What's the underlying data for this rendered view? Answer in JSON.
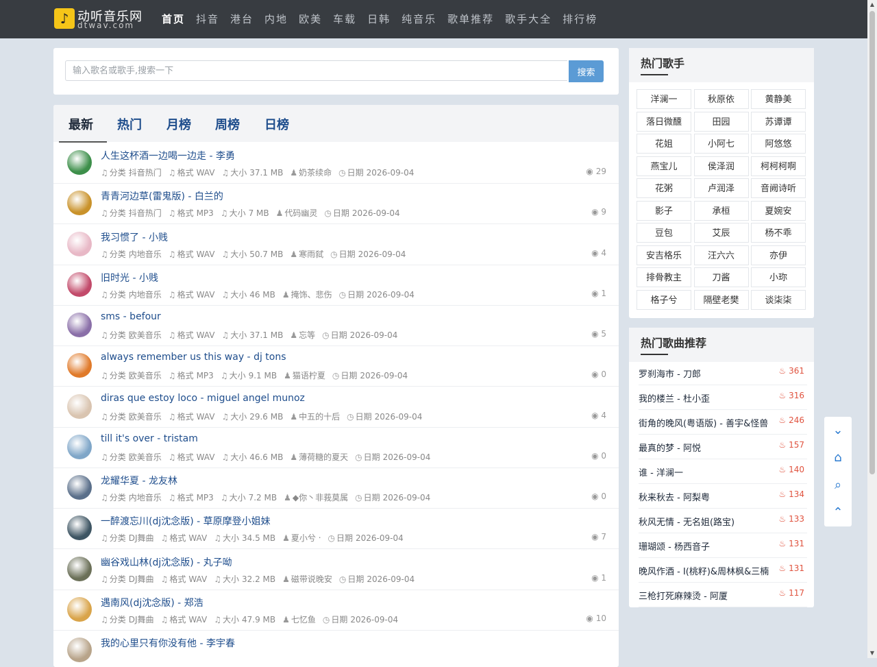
{
  "brand": {
    "name": "动听音乐网",
    "domain": "dtwav.com",
    "logo_glyph": "♪"
  },
  "nav": [
    "首页",
    "抖音",
    "港台",
    "内地",
    "欧美",
    "车载",
    "日韩",
    "纯音乐",
    "歌单推荐",
    "歌手大全",
    "排行榜"
  ],
  "search": {
    "placeholder": "输入歌名或歌手,搜索一下",
    "button": "搜索",
    "value": ""
  },
  "tabs": [
    "最新",
    "热门",
    "月榜",
    "周榜",
    "日榜"
  ],
  "meta_labels": {
    "category": "分类",
    "format": "格式",
    "size": "大小",
    "date": "日期"
  },
  "songs": [
    {
      "title": "人生这杯酒一边喝一边走 - 李勇",
      "category": "抖音热门",
      "format": "WAV",
      "size": "37.1 MB",
      "uploader": "奶茶续命",
      "date": "2026-09-04",
      "views": "29",
      "color": "#3d8f4a"
    },
    {
      "title": "青青河边草(雷鬼版) - 白兰的",
      "category": "抖音热门",
      "format": "MP3",
      "size": "7 MB",
      "uploader": "代码幽灵",
      "date": "2026-09-04",
      "views": "9",
      "color": "#c9922a"
    },
    {
      "title": "我习惯了 - 小贱",
      "category": "内地音乐",
      "format": "WAV",
      "size": "50.7 MB",
      "uploader": "寒雨弑",
      "date": "2026-09-04",
      "views": "4",
      "color": "#e8b8c6"
    },
    {
      "title": "旧时光 - 小贱",
      "category": "内地音乐",
      "format": "WAV",
      "size": "46 MB",
      "uploader": "掩饰、悲伤",
      "date": "2026-09-04",
      "views": "1",
      "color": "#c24a6a"
    },
    {
      "title": "sms - befour",
      "category": "欧美音乐",
      "format": "WAV",
      "size": "37.1 MB",
      "uploader": "忘等",
      "date": "2026-09-04",
      "views": "5",
      "color": "#8a6fa8"
    },
    {
      "title": "always remember us this way - dj tons",
      "category": "欧美音乐",
      "format": "MP3",
      "size": "9.1 MB",
      "uploader": "猫语柠夏",
      "date": "2026-09-04",
      "views": "0",
      "color": "#e07a2a"
    },
    {
      "title": "diras que estoy loco - miguel angel munoz",
      "category": "欧美音乐",
      "format": "WAV",
      "size": "29.6 MB",
      "uploader": "中五的十后",
      "date": "2026-09-04",
      "views": "4",
      "color": "#d9c4b0"
    },
    {
      "title": "till it's over - tristam",
      "category": "欧美音乐",
      "format": "WAV",
      "size": "46.6 MB",
      "uploader": "薄荷糖的夏天",
      "date": "2026-09-04",
      "views": "0",
      "color": "#7fa6c8"
    },
    {
      "title": "龙耀华夏 - 龙友林",
      "category": "内地音乐",
      "format": "MP3",
      "size": "7.2 MB",
      "uploader": "◆你丶非莪莫属",
      "date": "2026-09-04",
      "views": "0",
      "color": "#5a6f8a"
    },
    {
      "title": "一醉渡忘川(dj沈念版) - 草原摩登小姐妹",
      "category": "DJ舞曲",
      "format": "WAV",
      "size": "34.5 MB",
      "uploader": "夏小兮 ‧",
      "date": "2026-09-04",
      "views": "7",
      "color": "#3e5563"
    },
    {
      "title": "幽谷戏山林(dj沈念版) - 丸子呦",
      "category": "DJ舞曲",
      "format": "WAV",
      "size": "32.2 MB",
      "uploader": "磁带说晚安",
      "date": "2026-09-04",
      "views": "1",
      "color": "#6b7058"
    },
    {
      "title": "遇南风(dj沈念版) - 郑浩",
      "category": "DJ舞曲",
      "format": "WAV",
      "size": "47.9 MB",
      "uploader": "七忆鱼",
      "date": "2026-09-04",
      "views": "10",
      "color": "#d9a44a"
    },
    {
      "title": "我的心里只有你没有他 - 李宇春",
      "category": "",
      "format": "",
      "size": "",
      "uploader": "",
      "date": "",
      "views": "",
      "color": "#b8a48a"
    }
  ],
  "hot_singers": {
    "title": "热门歌手",
    "names": [
      "洋澜一",
      "秋原依",
      "黄静美",
      "落日微醺",
      "田园",
      "苏谭谭",
      "花姐",
      "小阿七",
      "阿悠悠",
      "燕宝儿",
      "侯泽润",
      "柯柯柯啊",
      "花粥",
      "卢润泽",
      "音阙诗听",
      "影子",
      "承桓",
      "夏婉安",
      "豆包",
      "艾辰",
      "杨不乖",
      "安吉格乐",
      "汪六六",
      "亦伊",
      "排骨教主",
      "刀酱",
      "小珎",
      "格子兮",
      "隔壁老樊",
      "谈柒柒"
    ]
  },
  "hot_songs": {
    "title": "热门歌曲推荐",
    "items": [
      {
        "name": "罗刹海市 - 刀郎",
        "count": "361"
      },
      {
        "name": "我的楼兰 - 杜小歪",
        "count": "316"
      },
      {
        "name": "街角的晚风(粤语版) - 善宇&怪兽",
        "count": "246"
      },
      {
        "name": "最真的梦 - 阿悦",
        "count": "157"
      },
      {
        "name": "谁 - 洋澜一",
        "count": "140"
      },
      {
        "name": "秋来秋去 - 阿梨粤",
        "count": "134"
      },
      {
        "name": "秋风无情 - 无名姐(路宝)",
        "count": "133"
      },
      {
        "name": "珊瑚颂 - 杨西音子",
        "count": "131"
      },
      {
        "name": "晚风作酒 - I(桃籽)&周林枫&三楠",
        "count": "131"
      },
      {
        "name": "三枪打死麻辣烫 - 阿厦",
        "count": "117"
      }
    ]
  },
  "tools": [
    {
      "name": "chevron-down-icon",
      "glyph": "⌄"
    },
    {
      "name": "home-icon",
      "glyph": "⌂"
    },
    {
      "name": "search-icon",
      "glyph": "⌕"
    },
    {
      "name": "chevron-up-icon",
      "glyph": "⌃"
    }
  ],
  "colors": {
    "topbar": "#383c41",
    "link": "#1e4d8c",
    "accent": "#5b9bd5",
    "hot": "#e0533f"
  }
}
